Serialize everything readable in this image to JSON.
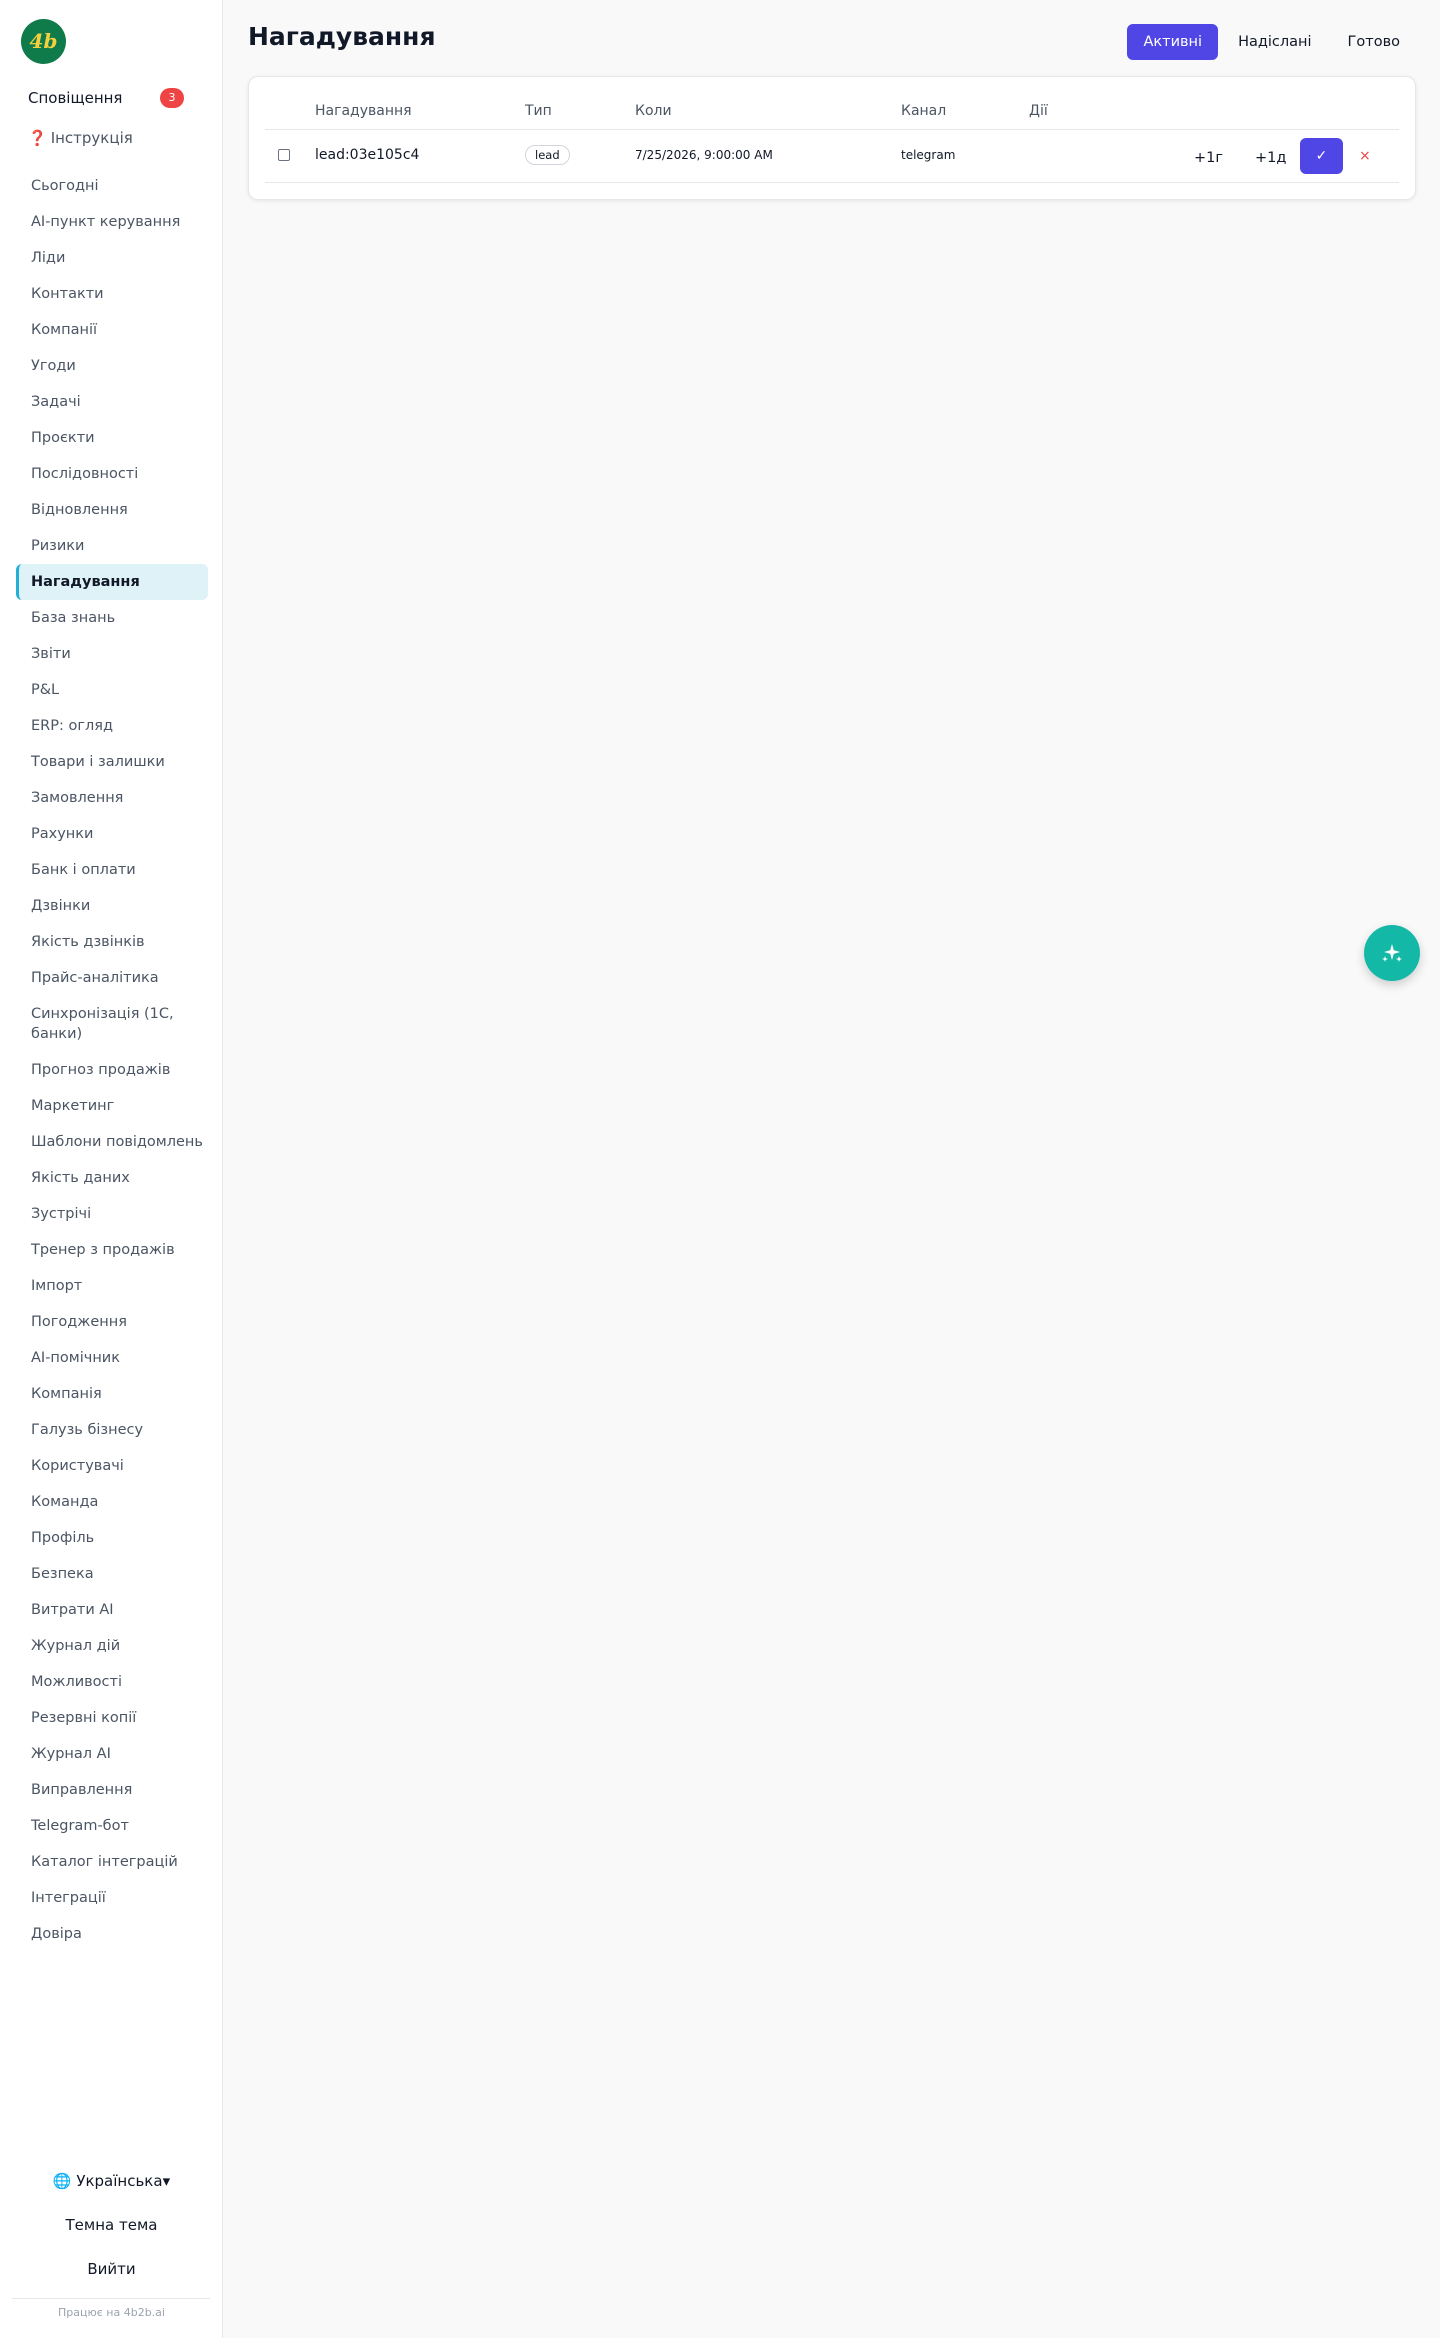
{
  "sidebar": {
    "logo_text": "4b",
    "notifications": {
      "label": "Сповіщення",
      "count": "3"
    },
    "help": {
      "icon": "❓",
      "label": "Інструкція"
    },
    "items": [
      "Сьогодні",
      "AI-пункт керування",
      "Ліди",
      "Контакти",
      "Компанії",
      "Угоди",
      "Задачі",
      "Проєкти",
      "Послідовності",
      "Відновлення",
      "Ризики",
      "Нагадування",
      "База знань",
      "Звіти",
      "P&L",
      "ERP: огляд",
      "Товари і залишки",
      "Замовлення",
      "Рахунки",
      "Банк і оплати",
      "Дзвінки",
      "Якість дзвінків",
      "Прайс-аналітика",
      "Синхронізація (1С, банки)",
      "Прогноз продажів",
      "Маркетинг",
      "Шаблони повідомлень",
      "Якість даних",
      "Зустрічі",
      "Тренер з продажів",
      "Імпорт",
      "Погодження",
      "AI-помічник",
      "Компанія",
      "Галузь бізнесу",
      "Користувачі",
      "Команда",
      "Профіль",
      "Безпека",
      "Витрати AI",
      "Журнал дій",
      "Можливості",
      "Резервні копії",
      "Журнал AI",
      "Виправлення",
      "Telegram-бот",
      "Каталог інтеграцій",
      "Інтеграції",
      "Довіра"
    ],
    "active_item": "Нагадування",
    "language": "🌐 Українська▾",
    "theme_toggle": "Темна тема",
    "logout": "Вийти",
    "powered_by": "Працює на 4b2b.ai"
  },
  "header": {
    "title": "Нагадування",
    "tabs": [
      "Активні",
      "Надіслані",
      "Готово"
    ],
    "active_tab": "Активні"
  },
  "table": {
    "columns": [
      "Нагадування",
      "Тип",
      "Коли",
      "Канал",
      "Дії"
    ],
    "rows": [
      {
        "name": "lead:03e105c4",
        "type": "lead",
        "when": "7/25/2026, 9:00:00 AM",
        "channel": "telegram",
        "actions": {
          "snooze_hour": "+1г",
          "snooze_day": "+1д",
          "done": "✓",
          "delete": "×"
        }
      }
    ]
  },
  "fab": {
    "icon": "sparkles-icon"
  },
  "colors": {
    "accent": "#4f46e5",
    "fab": "#14b8a6",
    "badge": "#ef4444",
    "active_nav_bg": "#dff2f8",
    "logo_bg": "#0f7a4a"
  }
}
